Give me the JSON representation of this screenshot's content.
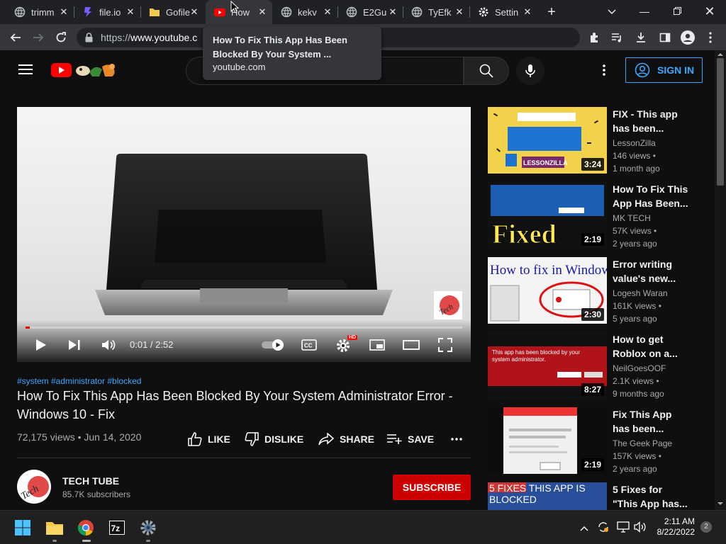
{
  "browser": {
    "tabs": [
      {
        "title": "trimm"
      },
      {
        "title": "file.io"
      },
      {
        "title": "Gofile"
      },
      {
        "title": "How"
      },
      {
        "title": "kekv"
      },
      {
        "title": "E2Gu"
      },
      {
        "title": "TyEfk"
      },
      {
        "title": "Settin"
      }
    ],
    "url_prefix": "https://",
    "url_host": "www.youtube.c",
    "tooltip": {
      "title": "How To Fix This App Has Been Blocked By Your System ...",
      "domain": "youtube.com"
    }
  },
  "youtube": {
    "sign_in_label": "SIGN IN",
    "player": {
      "time": "0:01 / 2:52",
      "progress_fraction": 0.01,
      "hd_badge": "HD"
    },
    "tags": "#system #administrator #blocked",
    "title": "How To Fix This App Has Been Blocked By Your System Administrator Error - Windows 10 - Fix",
    "meta": "72,175 views • Jun 14, 2020",
    "actions": {
      "like": "LIKE",
      "dislike": "DISLIKE",
      "share": "SHARE",
      "save": "SAVE"
    },
    "channel": {
      "name": "TECH TUBE",
      "subscribers": "85.7K subscribers",
      "subscribe_label": "SUBSCRIBE"
    },
    "recommendations": [
      {
        "title1": "FIX - This app",
        "title2": "has been...",
        "channel": "LessonZilla",
        "views": "146 views •",
        "age": "1 month ago",
        "duration": "3:24",
        "thumb_text": "LESSONZILLA"
      },
      {
        "title1": "How To Fix This",
        "title2": "App Has Been...",
        "channel": "MK TECH",
        "views": "57K views •",
        "age": "2 years ago",
        "duration": "2:19",
        "thumb_text": "Fixed"
      },
      {
        "title1": "Error writing",
        "title2": "value's new...",
        "channel": "Logesh Waran",
        "views": "161K views •",
        "age": "5 years ago",
        "duration": "2:30",
        "thumb_text": "How to fix in Windows..."
      },
      {
        "title1": "How to get",
        "title2": "Roblox on a...",
        "channel": "NeilGoesOOF",
        "views": "2.1K views •",
        "age": "9 months ago",
        "duration": "8:27",
        "thumb_text": "This app has been blocked by your system administrator."
      },
      {
        "title1": "Fix This App",
        "title2": "has been...",
        "channel": "The Geek Page",
        "views": "157K views •",
        "age": "2 years ago",
        "duration": "2:19",
        "thumb_text": ""
      },
      {
        "title1": "5 Fixes for",
        "title2": "\"This App has...",
        "channel": "",
        "views": "",
        "age": "",
        "duration": "",
        "thumb_text": "5 FIXES THIS APP IS BLOCKED"
      }
    ]
  },
  "taskbar": {
    "time": "2:11 AM",
    "date": "8/22/2022",
    "notifications": "2"
  },
  "colors": {
    "accent_blue": "#3ea6ff",
    "youtube_red": "#cc0000",
    "progress_red": "#ff0000"
  }
}
